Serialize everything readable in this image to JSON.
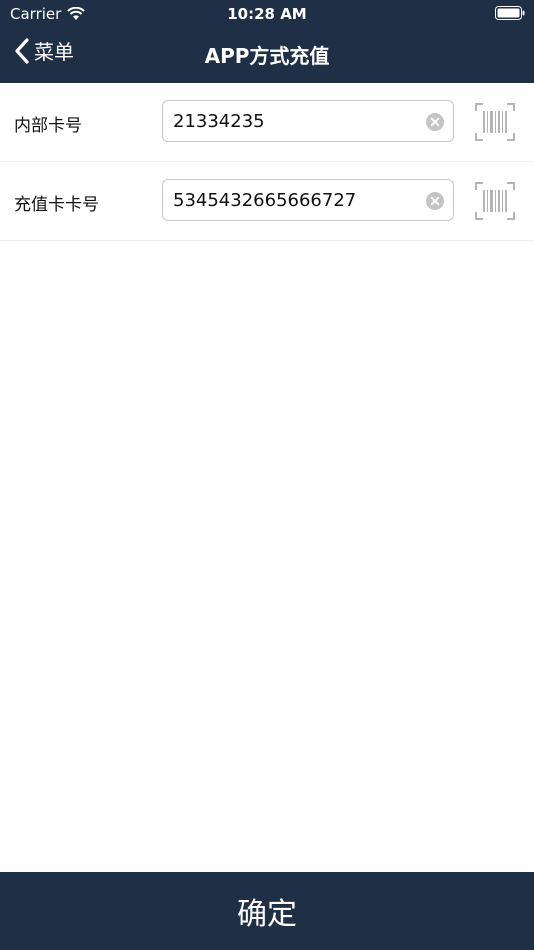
{
  "status_bar": {
    "carrier": "Carrier",
    "time": "10:28 AM"
  },
  "nav": {
    "back_label": "菜单",
    "title": "APP方式充值"
  },
  "form": {
    "rows": [
      {
        "label": "内部卡号",
        "value": "21334235"
      },
      {
        "label": "充值卡卡号",
        "value": "5345432665666727"
      }
    ]
  },
  "footer": {
    "confirm_label": "确定"
  },
  "colors": {
    "primary": "#1f2f45",
    "background": "#ffffff"
  }
}
